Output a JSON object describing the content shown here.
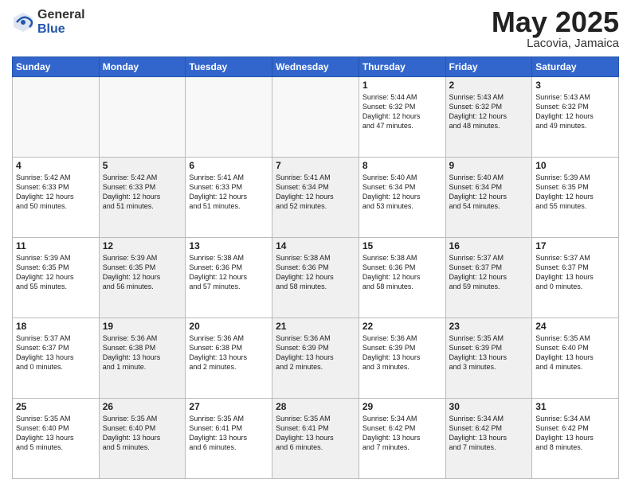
{
  "header": {
    "logo_general": "General",
    "logo_blue": "Blue",
    "title": "May 2025",
    "location": "Lacovia, Jamaica"
  },
  "days_of_week": [
    "Sunday",
    "Monday",
    "Tuesday",
    "Wednesday",
    "Thursday",
    "Friday",
    "Saturday"
  ],
  "weeks": [
    [
      {
        "day": "",
        "info": "",
        "empty": true
      },
      {
        "day": "",
        "info": "",
        "empty": true
      },
      {
        "day": "",
        "info": "",
        "empty": true
      },
      {
        "day": "",
        "info": "",
        "empty": true
      },
      {
        "day": "1",
        "info": "Sunrise: 5:44 AM\nSunset: 6:32 PM\nDaylight: 12 hours\nand 47 minutes.",
        "shaded": false
      },
      {
        "day": "2",
        "info": "Sunrise: 5:43 AM\nSunset: 6:32 PM\nDaylight: 12 hours\nand 48 minutes.",
        "shaded": true
      },
      {
        "day": "3",
        "info": "Sunrise: 5:43 AM\nSunset: 6:32 PM\nDaylight: 12 hours\nand 49 minutes.",
        "shaded": false
      }
    ],
    [
      {
        "day": "4",
        "info": "Sunrise: 5:42 AM\nSunset: 6:33 PM\nDaylight: 12 hours\nand 50 minutes.",
        "shaded": false
      },
      {
        "day": "5",
        "info": "Sunrise: 5:42 AM\nSunset: 6:33 PM\nDaylight: 12 hours\nand 51 minutes.",
        "shaded": true
      },
      {
        "day": "6",
        "info": "Sunrise: 5:41 AM\nSunset: 6:33 PM\nDaylight: 12 hours\nand 51 minutes.",
        "shaded": false
      },
      {
        "day": "7",
        "info": "Sunrise: 5:41 AM\nSunset: 6:34 PM\nDaylight: 12 hours\nand 52 minutes.",
        "shaded": true
      },
      {
        "day": "8",
        "info": "Sunrise: 5:40 AM\nSunset: 6:34 PM\nDaylight: 12 hours\nand 53 minutes.",
        "shaded": false
      },
      {
        "day": "9",
        "info": "Sunrise: 5:40 AM\nSunset: 6:34 PM\nDaylight: 12 hours\nand 54 minutes.",
        "shaded": true
      },
      {
        "day": "10",
        "info": "Sunrise: 5:39 AM\nSunset: 6:35 PM\nDaylight: 12 hours\nand 55 minutes.",
        "shaded": false
      }
    ],
    [
      {
        "day": "11",
        "info": "Sunrise: 5:39 AM\nSunset: 6:35 PM\nDaylight: 12 hours\nand 55 minutes.",
        "shaded": false
      },
      {
        "day": "12",
        "info": "Sunrise: 5:39 AM\nSunset: 6:35 PM\nDaylight: 12 hours\nand 56 minutes.",
        "shaded": true
      },
      {
        "day": "13",
        "info": "Sunrise: 5:38 AM\nSunset: 6:36 PM\nDaylight: 12 hours\nand 57 minutes.",
        "shaded": false
      },
      {
        "day": "14",
        "info": "Sunrise: 5:38 AM\nSunset: 6:36 PM\nDaylight: 12 hours\nand 58 minutes.",
        "shaded": true
      },
      {
        "day": "15",
        "info": "Sunrise: 5:38 AM\nSunset: 6:36 PM\nDaylight: 12 hours\nand 58 minutes.",
        "shaded": false
      },
      {
        "day": "16",
        "info": "Sunrise: 5:37 AM\nSunset: 6:37 PM\nDaylight: 12 hours\nand 59 minutes.",
        "shaded": true
      },
      {
        "day": "17",
        "info": "Sunrise: 5:37 AM\nSunset: 6:37 PM\nDaylight: 13 hours\nand 0 minutes.",
        "shaded": false
      }
    ],
    [
      {
        "day": "18",
        "info": "Sunrise: 5:37 AM\nSunset: 6:37 PM\nDaylight: 13 hours\nand 0 minutes.",
        "shaded": false
      },
      {
        "day": "19",
        "info": "Sunrise: 5:36 AM\nSunset: 6:38 PM\nDaylight: 13 hours\nand 1 minute.",
        "shaded": true
      },
      {
        "day": "20",
        "info": "Sunrise: 5:36 AM\nSunset: 6:38 PM\nDaylight: 13 hours\nand 2 minutes.",
        "shaded": false
      },
      {
        "day": "21",
        "info": "Sunrise: 5:36 AM\nSunset: 6:39 PM\nDaylight: 13 hours\nand 2 minutes.",
        "shaded": true
      },
      {
        "day": "22",
        "info": "Sunrise: 5:36 AM\nSunset: 6:39 PM\nDaylight: 13 hours\nand 3 minutes.",
        "shaded": false
      },
      {
        "day": "23",
        "info": "Sunrise: 5:35 AM\nSunset: 6:39 PM\nDaylight: 13 hours\nand 3 minutes.",
        "shaded": true
      },
      {
        "day": "24",
        "info": "Sunrise: 5:35 AM\nSunset: 6:40 PM\nDaylight: 13 hours\nand 4 minutes.",
        "shaded": false
      }
    ],
    [
      {
        "day": "25",
        "info": "Sunrise: 5:35 AM\nSunset: 6:40 PM\nDaylight: 13 hours\nand 5 minutes.",
        "shaded": false
      },
      {
        "day": "26",
        "info": "Sunrise: 5:35 AM\nSunset: 6:40 PM\nDaylight: 13 hours\nand 5 minutes.",
        "shaded": true
      },
      {
        "day": "27",
        "info": "Sunrise: 5:35 AM\nSunset: 6:41 PM\nDaylight: 13 hours\nand 6 minutes.",
        "shaded": false
      },
      {
        "day": "28",
        "info": "Sunrise: 5:35 AM\nSunset: 6:41 PM\nDaylight: 13 hours\nand 6 minutes.",
        "shaded": true
      },
      {
        "day": "29",
        "info": "Sunrise: 5:34 AM\nSunset: 6:42 PM\nDaylight: 13 hours\nand 7 minutes.",
        "shaded": false
      },
      {
        "day": "30",
        "info": "Sunrise: 5:34 AM\nSunset: 6:42 PM\nDaylight: 13 hours\nand 7 minutes.",
        "shaded": true
      },
      {
        "day": "31",
        "info": "Sunrise: 5:34 AM\nSunset: 6:42 PM\nDaylight: 13 hours\nand 8 minutes.",
        "shaded": false
      }
    ]
  ]
}
